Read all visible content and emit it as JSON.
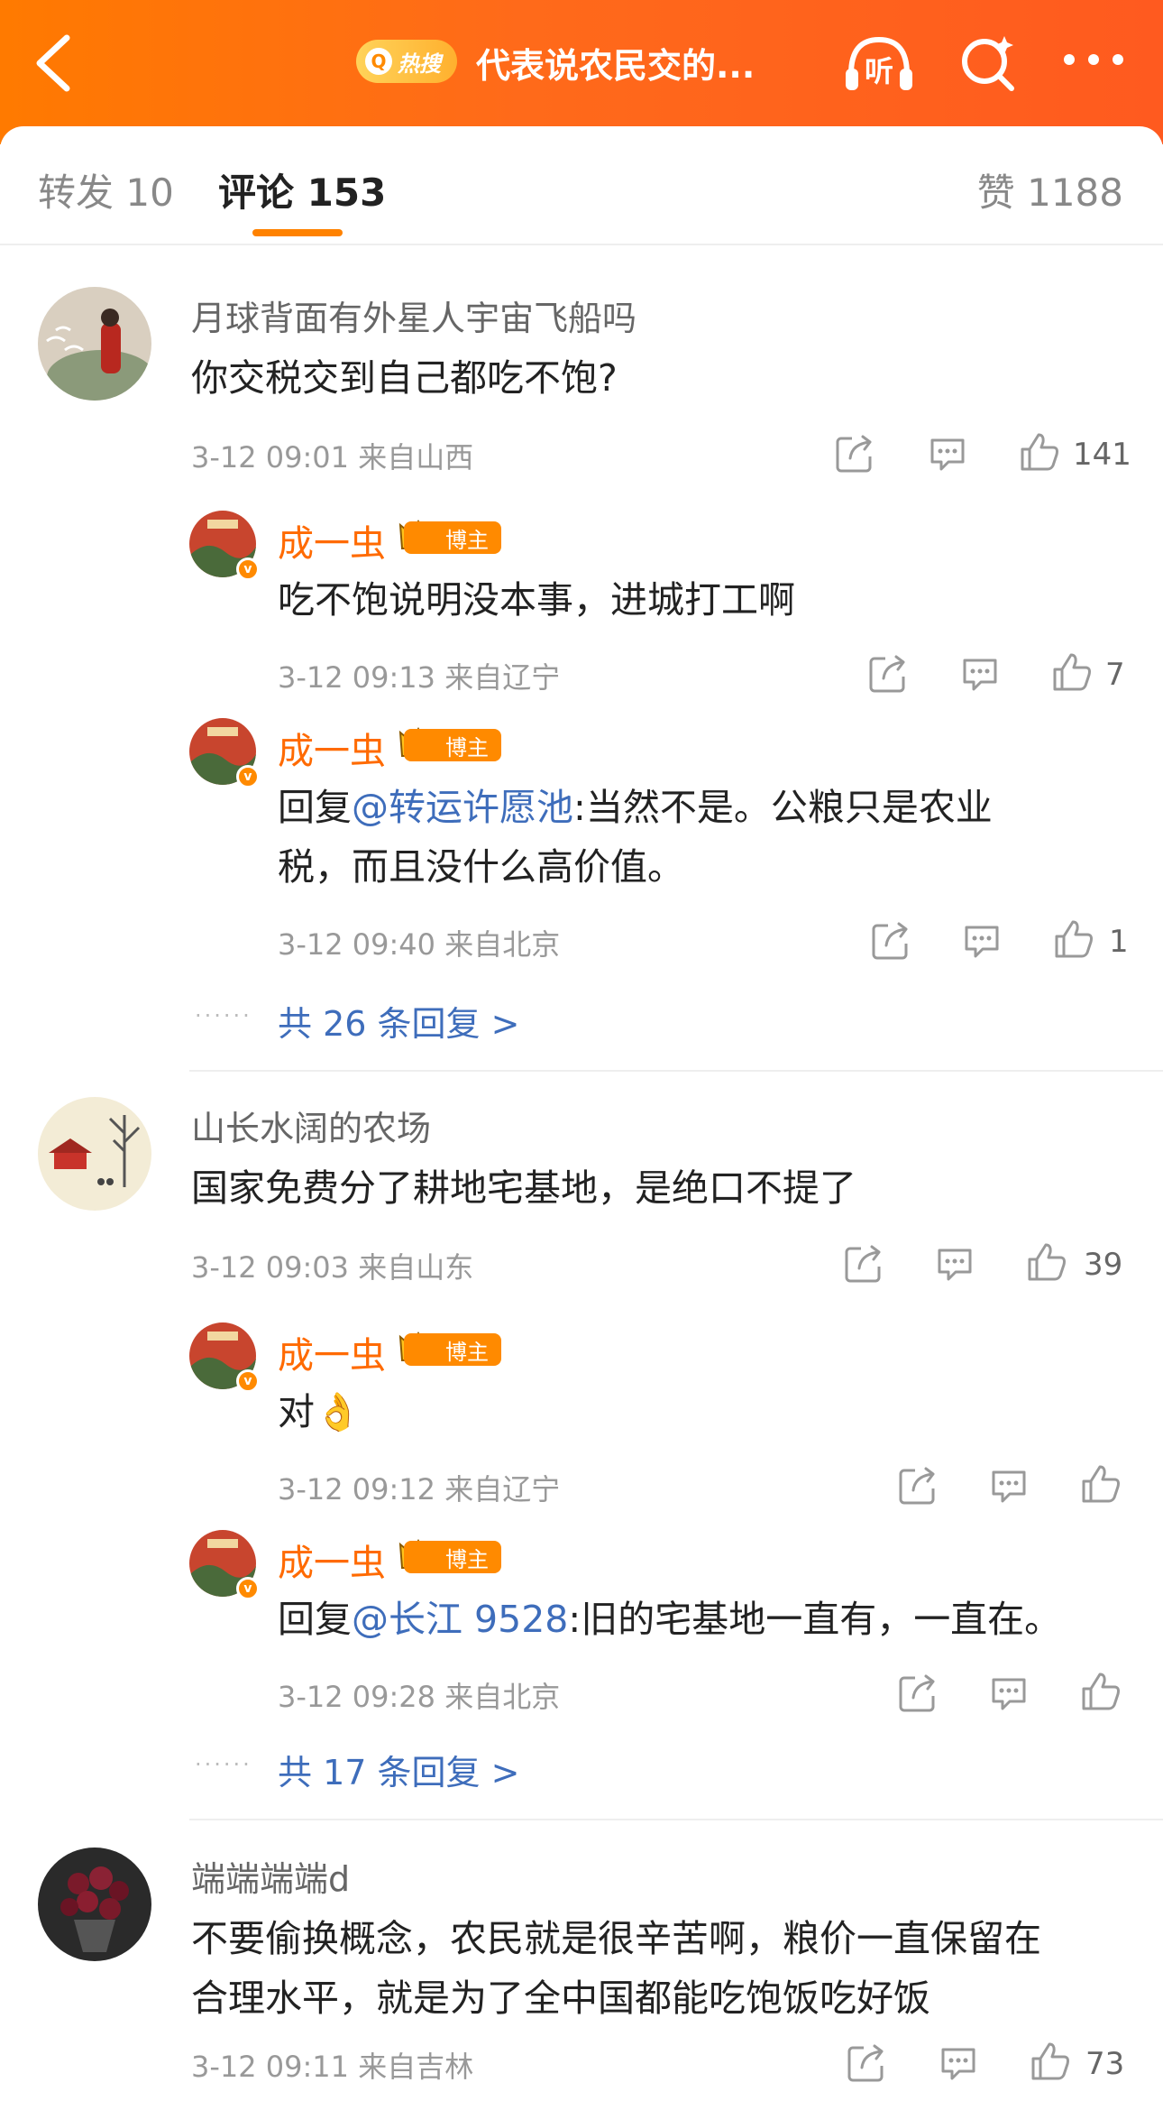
{
  "header": {
    "hot_badge": "热搜",
    "title": "代表说农民交的...",
    "icons": [
      "back-icon",
      "listen-icon",
      "search-icon",
      "more-icon"
    ],
    "listen_label": "听",
    "accent": "#ff7a00"
  },
  "tabs": {
    "repost": "转发 10",
    "comment": "评论 153",
    "like": "赞 1188"
  },
  "comments": [
    {
      "user": "月球背面有外星人宇宙飞船吗",
      "text": "你交税交到自己都吃不饱?",
      "meta": "3-12 09:01 来自山西",
      "likes": "141",
      "replies": [
        {
          "user": "成一虫",
          "badge": "博主",
          "text": "吃不饱说明没本事，进城打工啊",
          "meta": "3-12 09:13 来自辽宁",
          "likes": "7"
        },
        {
          "user": "成一虫",
          "badge": "博主",
          "reply_prefix": "回复",
          "mention": "@转运许愿池",
          "text1": ":当然不是。公粮只是农业",
          "text2": "税，而且没什么高价值。",
          "meta": "3-12 09:40 来自北京",
          "likes": "1"
        }
      ],
      "more_replies": "共 26 条回复 >"
    },
    {
      "user": "山长水阔的农场",
      "text": "国家免费分了耕地宅基地，是绝口不提了",
      "meta": "3-12 09:03 来自山东",
      "likes": "39",
      "replies": [
        {
          "user": "成一虫",
          "badge": "博主",
          "text": "对👌",
          "meta": "3-12 09:12 来自辽宁",
          "likes": ""
        },
        {
          "user": "成一虫",
          "badge": "博主",
          "reply_prefix": "回复",
          "mention": "@长江 9528",
          "text1": ":旧的宅基地一直有，一直在。",
          "meta": "3-12 09:28 来自北京",
          "likes": ""
        }
      ],
      "more_replies": "共 17 条回复 >"
    },
    {
      "user": "端端端端d",
      "text1": "不要偷换概念，农民就是很辛苦啊，粮价一直保留在",
      "text2": "合理水平，就是为了全中国都能吃饱饭吃好饭",
      "meta": "3-12 09:11 来自吉林",
      "likes": "73"
    }
  ]
}
